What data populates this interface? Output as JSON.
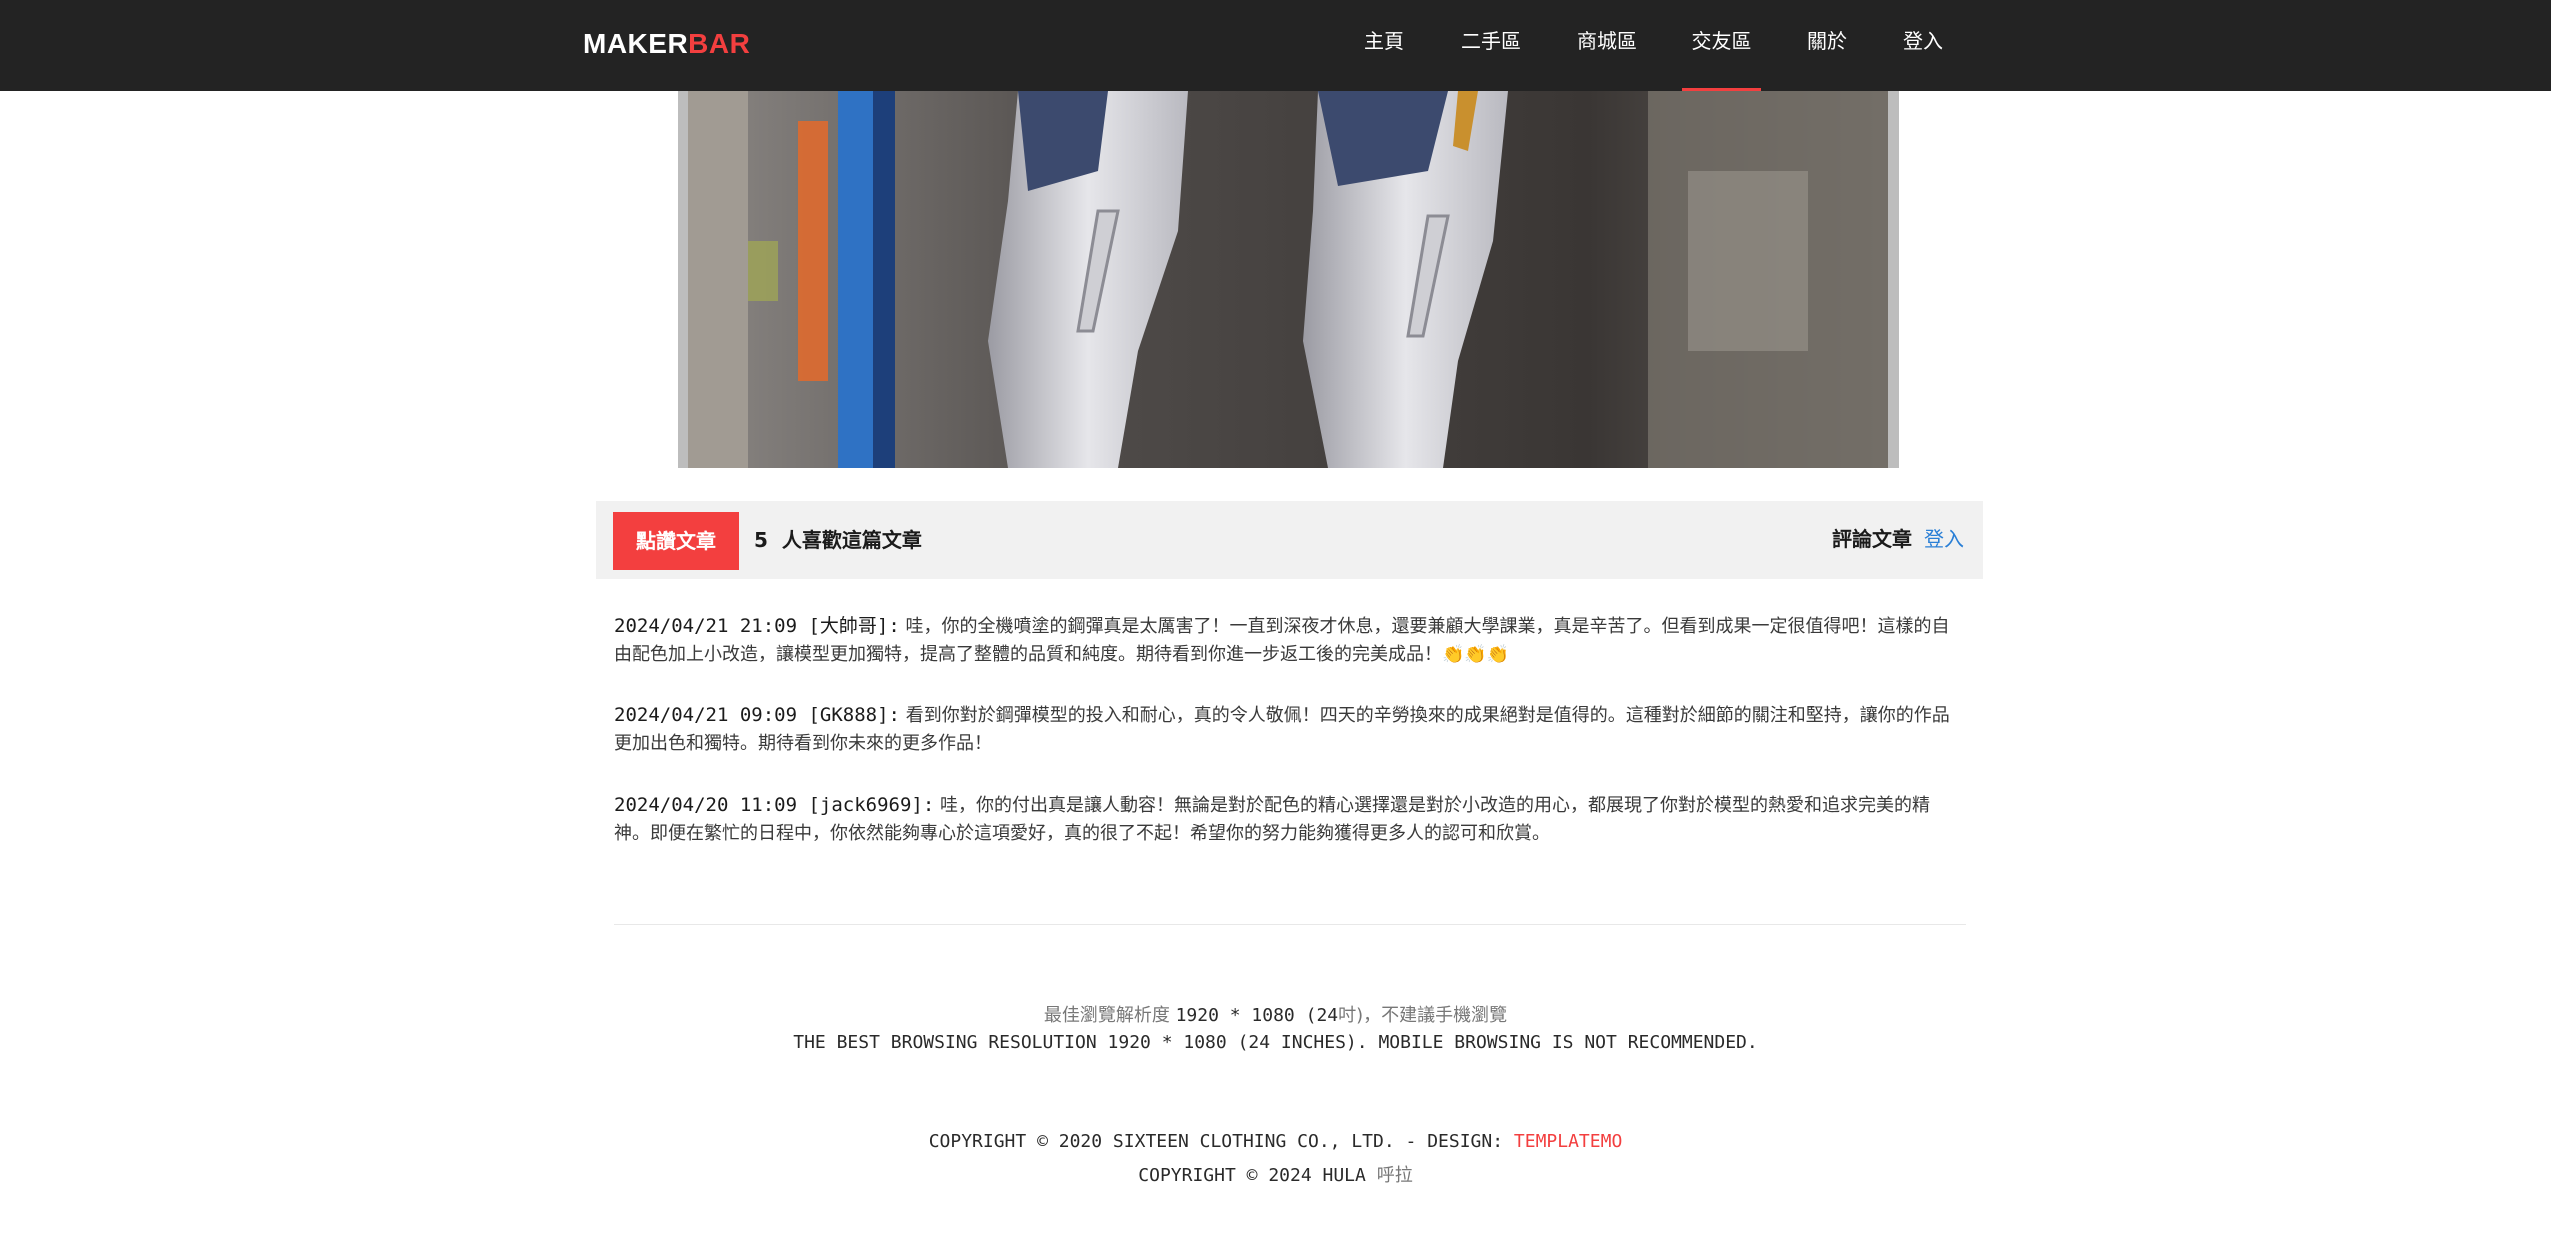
{
  "brand": {
    "part1": "MAKER",
    "part2": "BAR",
    "accent_color": "#f33f3f"
  },
  "nav": {
    "items": [
      {
        "label": "主頁"
      },
      {
        "label": "二手區"
      },
      {
        "label": "商城區"
      },
      {
        "label": "交友區",
        "active": true
      },
      {
        "label": "關於"
      },
      {
        "label": "登入"
      }
    ]
  },
  "hero": {
    "image": "gundam-model-legs-photo"
  },
  "like_bar": {
    "like_button": "點讚文章",
    "like_count": "5",
    "like_suffix": "人喜歡這篇文章",
    "comment_label": "評論文章",
    "login_link": "登入"
  },
  "comments": [
    {
      "meta": "2024/04/21 21:09 [大帥哥]:",
      "text": "哇，你的全機噴塗的鋼彈真是太厲害了！一直到深夜才休息，還要兼顧大學課業，真是辛苦了。但看到成果一定很值得吧！這樣的自由配色加上小改造，讓模型更加獨特，提高了整體的品質和純度。期待看到你進一步返工後的完美成品！👏👏👏"
    },
    {
      "meta": "2024/04/21 09:09 [GK888]:",
      "text": "看到你對於鋼彈模型的投入和耐心，真的令人敬佩！四天的辛勞換來的成果絕對是值得的。這種對於細節的關注和堅持，讓你的作品更加出色和獨特。期待看到你未來的更多作品！"
    },
    {
      "meta": "2024/04/20 11:09 [jack6969]:",
      "text": "哇，你的付出真是讓人動容！無論是對於配色的精心選擇還是對於小改造的用心，都展現了你對於模型的熱愛和追求完美的精神。即便在繁忙的日程中，你依然能夠專心於這項愛好，真的很了不起！希望你的努力能夠獲得更多人的認可和欣賞。"
    }
  ],
  "footer": {
    "res_zh_prefix": "最佳瀏覽解析度",
    "res_zh_value": "1920 * 1080 (24",
    "res_zh_suffix": "吋)，不建議手機瀏覽",
    "res_en": "THE BEST BROWSING RESOLUTION 1920 * 1080 (24 INCHES). MOBILE BROWSING IS NOT RECOMMENDED.",
    "copyright1_prefix": "COPYRIGHT © 2020 SIXTEEN CLOTHING CO., LTD. - DESIGN:",
    "copyright1_link": "TEMPLATEMO",
    "copyright2_prefix": "COPYRIGHT © 2024 HULA",
    "copyright2_suffix": "呼拉"
  }
}
